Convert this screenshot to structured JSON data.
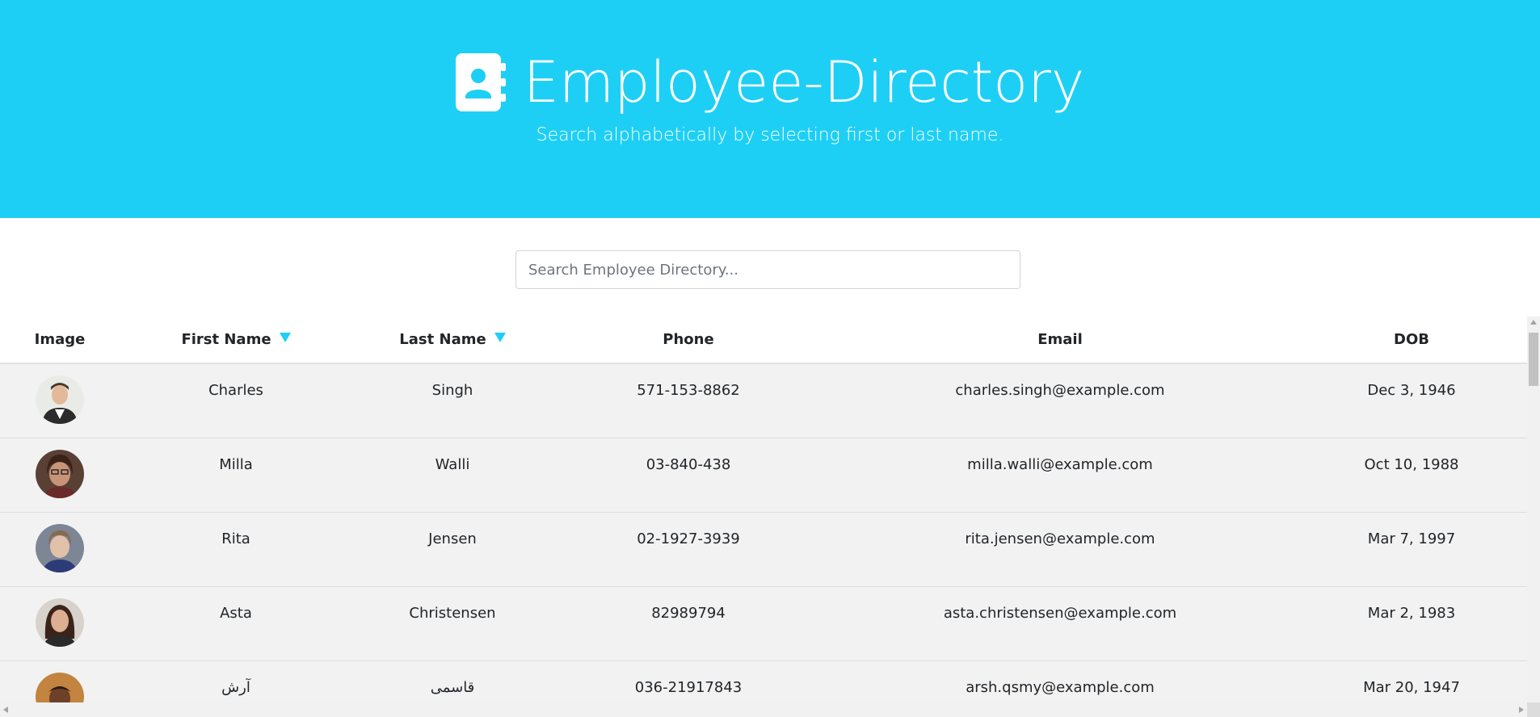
{
  "colors": {
    "brand": "#1ecff5",
    "row_bg": "#f2f2f2",
    "sort_arrow": "#1ecff5"
  },
  "header": {
    "icon": "address-book-icon",
    "title": "Employee-Directory",
    "subtitle": "Search alphabetically by selecting first or last name."
  },
  "search": {
    "placeholder": "Search Employee Directory...",
    "value": ""
  },
  "table": {
    "columns": {
      "image": "Image",
      "first_name": "First Name",
      "last_name": "Last Name",
      "phone": "Phone",
      "email": "Email",
      "dob": "DOB"
    },
    "sort_icon": "caret-down-icon",
    "rows": [
      {
        "first": "Charles",
        "last": "Singh",
        "phone": "571-153-8862",
        "email": "charles.singh@example.com",
        "dob": "Dec 3, 1946"
      },
      {
        "first": "Milla",
        "last": "Walli",
        "phone": "03-840-438",
        "email": "milla.walli@example.com",
        "dob": "Oct 10, 1988"
      },
      {
        "first": "Rita",
        "last": "Jensen",
        "phone": "02-1927-3939",
        "email": "rita.jensen@example.com",
        "dob": "Mar 7, 1997"
      },
      {
        "first": "Asta",
        "last": "Christensen",
        "phone": "82989794",
        "email": "asta.christensen@example.com",
        "dob": "Mar 2, 1983"
      },
      {
        "first": "آرش",
        "last": "قاسمی",
        "phone": "036-21917843",
        "email": "arsh.qsmy@example.com",
        "dob": "Mar 20, 1947"
      }
    ]
  }
}
